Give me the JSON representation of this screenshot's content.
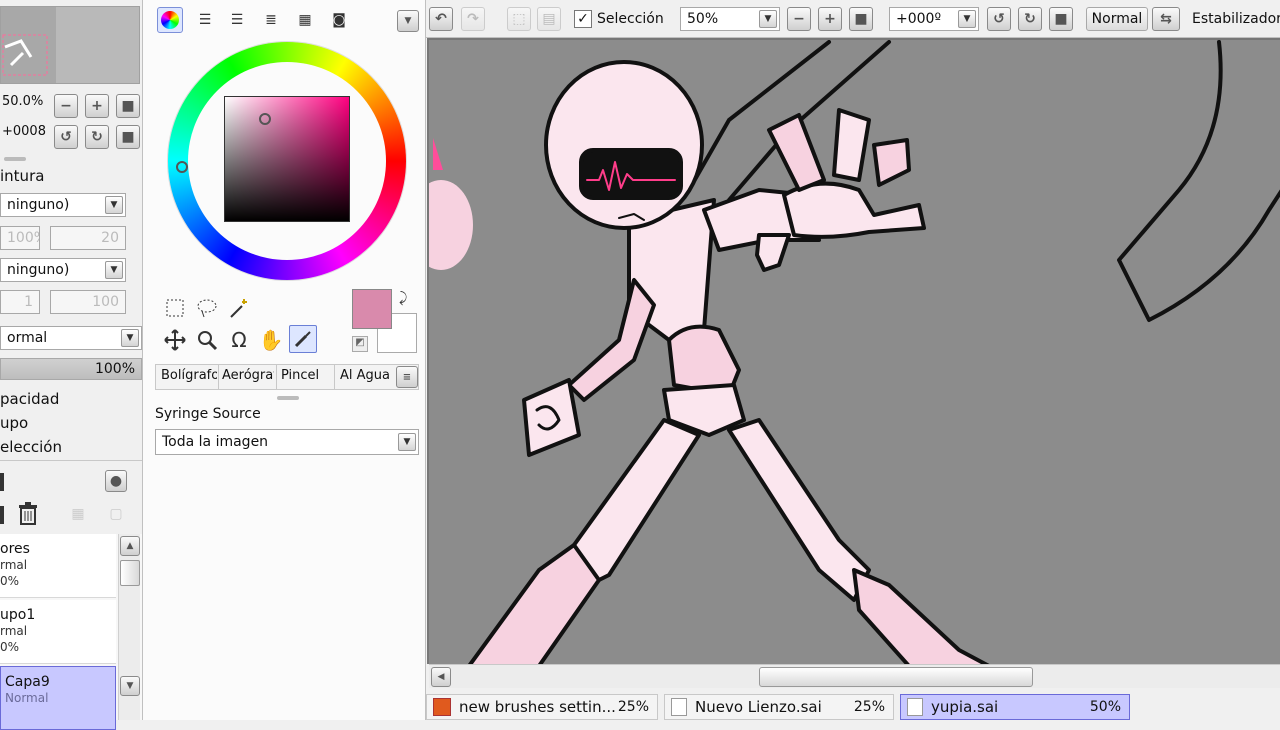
{
  "navigator": {
    "zoom": "50.0%",
    "angle": "+0008"
  },
  "left_panel": {
    "paint_section": "intura",
    "select_1": "ninguno)",
    "density_pct": "100%",
    "density_val": "20",
    "select_2": "ninguno)",
    "size_min": "1",
    "size_max": "100",
    "blend_mode": "ormal",
    "opacity_value": "100%",
    "opacity_label": "pacidad",
    "group_label": "upo",
    "selection_label": "elección"
  },
  "layers": [
    {
      "name": "ores",
      "mode": "rmal",
      "opacity": "0%"
    },
    {
      "name": "upo1",
      "mode": "rmal",
      "opacity": "0%"
    },
    {
      "name": "Capa9",
      "mode": "Normal",
      "opacity": ""
    }
  ],
  "color_panel": {
    "primary_color": "#d98aac",
    "secondary_color": "#ffffff"
  },
  "brush_tabs": [
    "Bolígrafo",
    "Aerógraf",
    "Pincel",
    "Al Agua"
  ],
  "tool_options": {
    "source_label": "Syringe Source",
    "source_value": "Toda la imagen"
  },
  "toolbar": {
    "selection_label": "Selección",
    "selection_checked": true,
    "zoom_value": "50%",
    "rotation_value": "+000º",
    "blend_value": "Normal",
    "stabilizer_label": "Estabilizador"
  },
  "documents": [
    {
      "name": "new brushes settin...",
      "zoom": "25%",
      "active": false
    },
    {
      "name": "Nuevo Lienzo.sai",
      "zoom": "25%",
      "active": false
    },
    {
      "name": "yupia.sai",
      "zoom": "50%",
      "active": true
    }
  ],
  "colors": {
    "canvas_bg": "#8c8c8c",
    "accent": "#c8c8ff",
    "figure_pink": "#f7d2e0",
    "visor_line": "#ff3d8a"
  }
}
